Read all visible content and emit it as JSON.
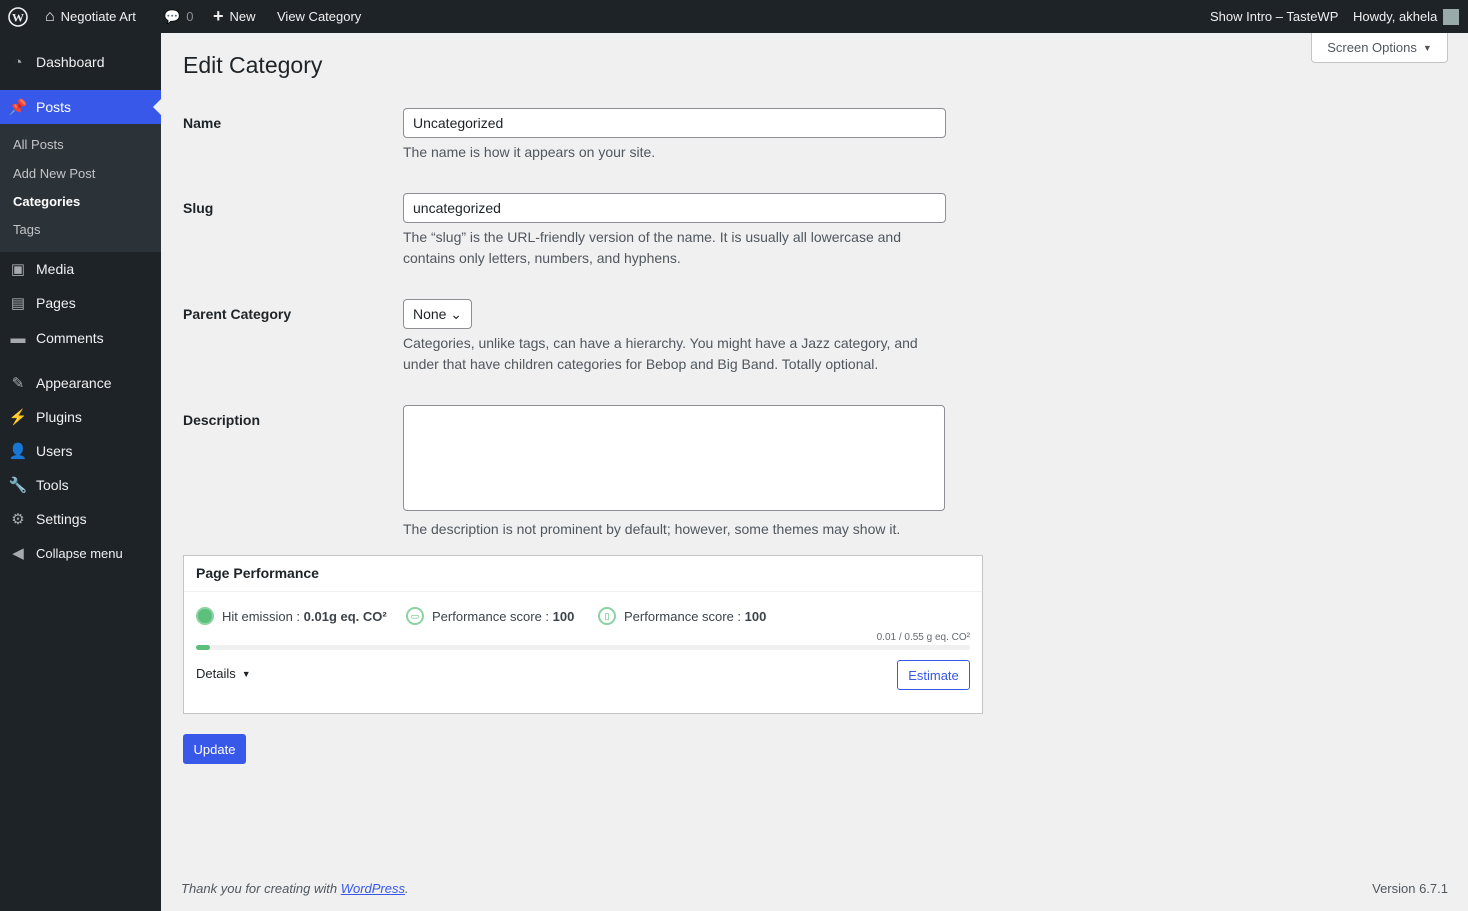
{
  "adminbar": {
    "site": "Negotiate Art",
    "comments": "0",
    "new": "New",
    "view": "View Category",
    "show_intro": "Show Intro – TasteWP",
    "howdy": "Howdy, akhela"
  },
  "sidebar": {
    "items": [
      "Dashboard",
      "Posts",
      "Media",
      "Pages",
      "Comments",
      "Appearance",
      "Plugins",
      "Users",
      "Tools",
      "Settings",
      "Collapse menu"
    ],
    "sub": [
      "All Posts",
      "Add New Post",
      "Categories",
      "Tags"
    ]
  },
  "screen_options": "Screen Options",
  "page_title": "Edit Category",
  "form": {
    "name_label": "Name",
    "name_value": "Uncategorized",
    "name_desc": "The name is how it appears on your site.",
    "slug_label": "Slug",
    "slug_value": "uncategorized",
    "slug_desc": "The “slug” is the URL-friendly version of the name. It is usually all lowercase and contains only letters, numbers, and hyphens.",
    "parent_label": "Parent Category",
    "parent_value": "None",
    "parent_desc": "Categories, unlike tags, can have a hierarchy. You might have a Jazz category, and under that have children categories for Bebop and Big Band. Totally optional.",
    "desc_label": "Description",
    "desc_value": "",
    "desc_desc": "The description is not prominent by default; however, some themes may show it."
  },
  "perf": {
    "title": "Page Performance",
    "hit_label": "Hit emission : ",
    "hit_value": "0.01g eq. CO²",
    "score_label": "Performance score : ",
    "score1": "100",
    "score2": "100",
    "ratio": "0.01 / 0.55 g eq. CO²",
    "progress_fraction": 0.018,
    "details": "Details",
    "estimate": "Estimate"
  },
  "update": "Update",
  "footer": {
    "thanks": "Thank you for creating with ",
    "link": "WordPress",
    "version": "Version 6.7.1"
  }
}
